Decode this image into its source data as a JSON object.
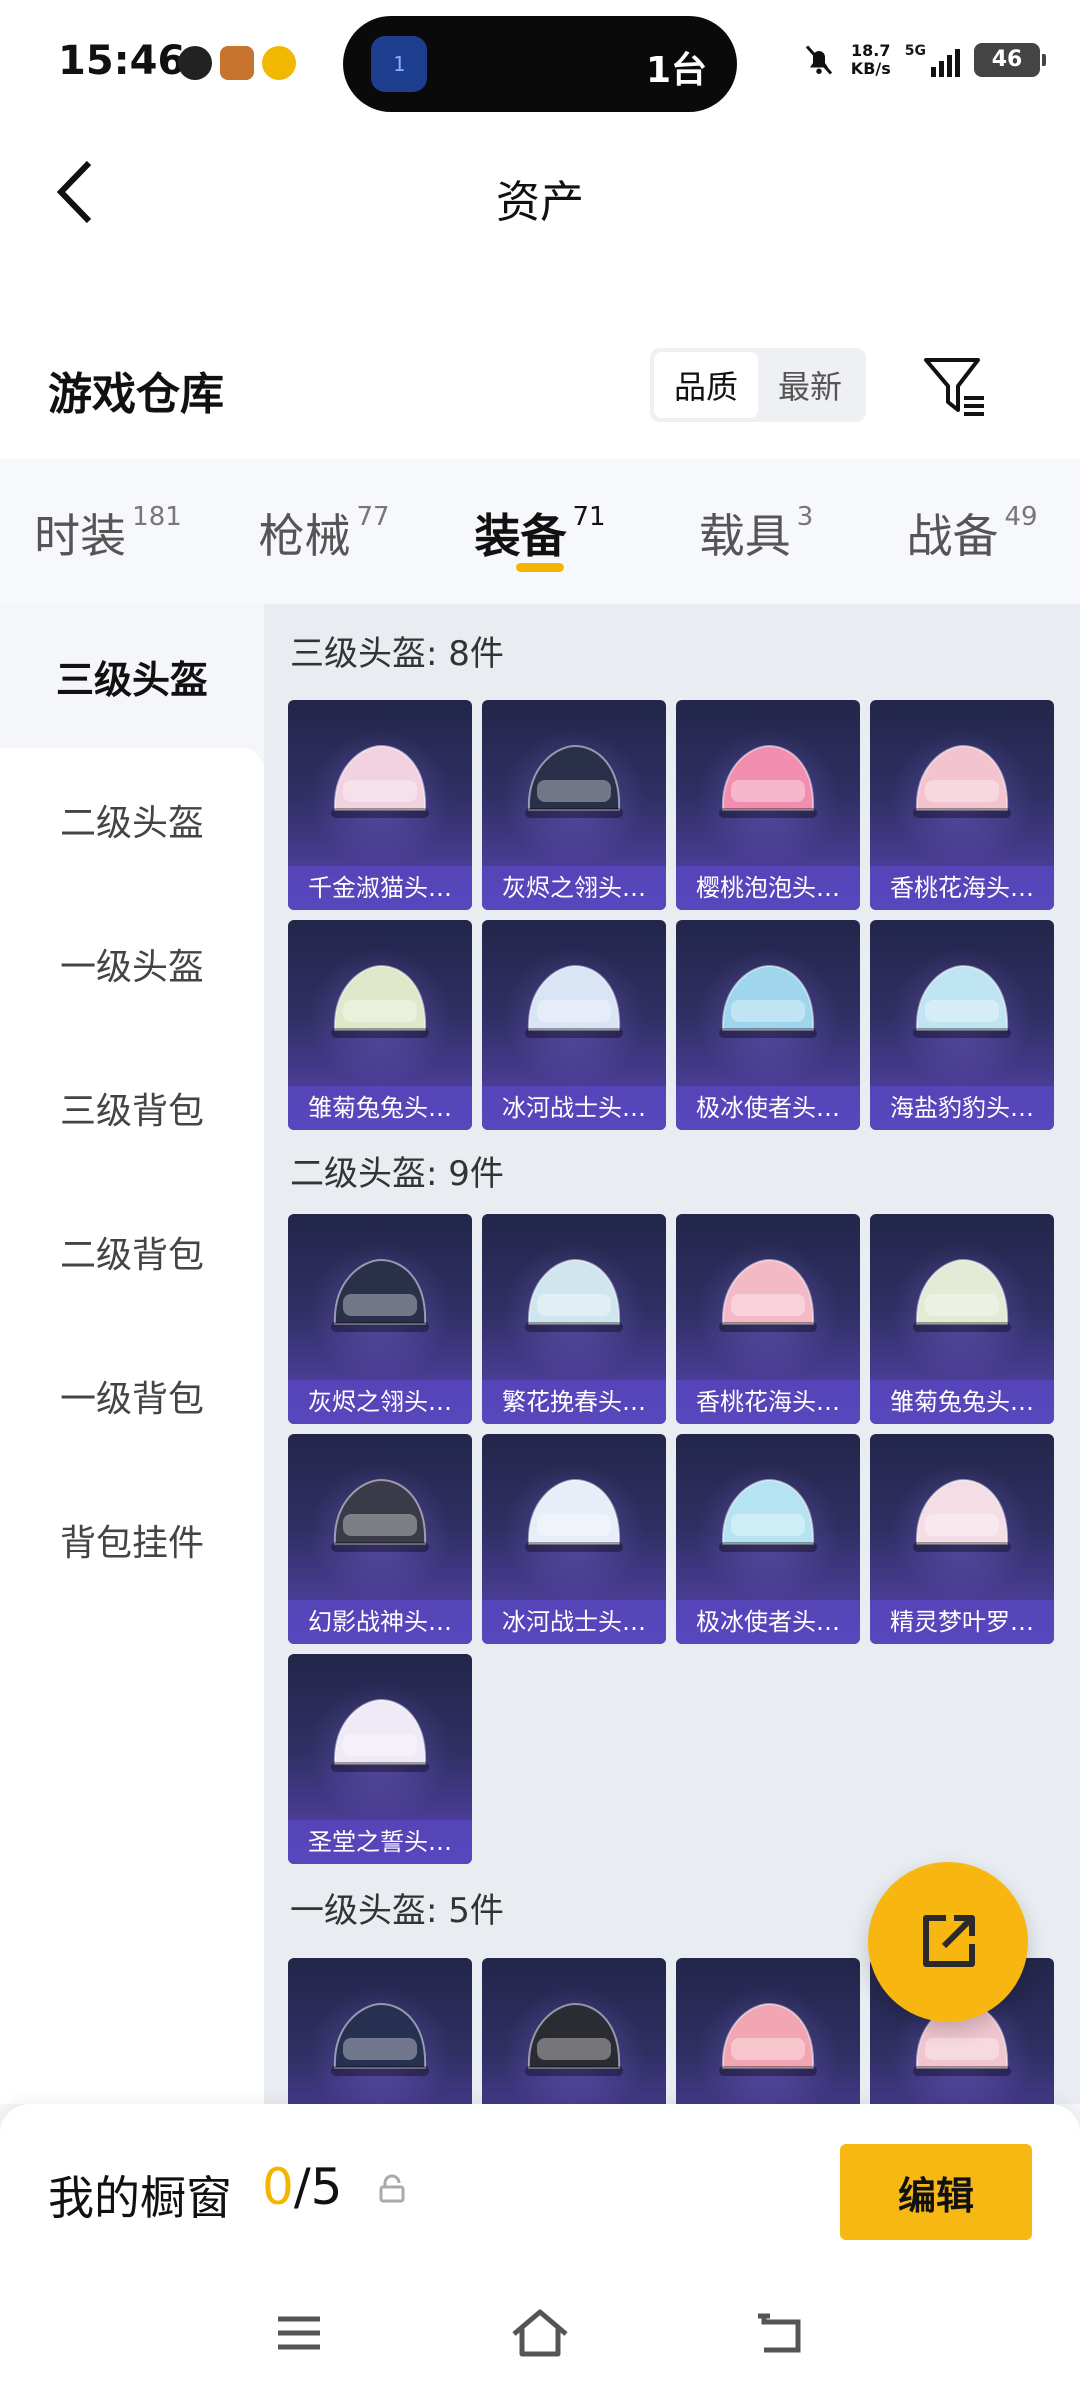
{
  "status_bar": {
    "time": "15:46",
    "island_icon_text": "1",
    "island_text": "1台",
    "net_speed_value": "18.7",
    "net_speed_unit": "KB/s",
    "network": "5G",
    "battery": "46"
  },
  "header": {
    "back_icon": "chevron-left-icon",
    "title": "资产"
  },
  "warehouse": {
    "title": "游戏仓库",
    "sort_options": [
      "品质",
      "最新"
    ],
    "active_sort": "品质",
    "filter_icon": "filter-icon"
  },
  "tabs": [
    {
      "label": "时装",
      "count": "181"
    },
    {
      "label": "枪械",
      "count": "77"
    },
    {
      "label": "装备",
      "count": "71"
    },
    {
      "label": "载具",
      "count": "3"
    },
    {
      "label": "战备",
      "count": "49"
    }
  ],
  "active_tab": "装备",
  "sidebar": [
    {
      "label": "三级头盔"
    },
    {
      "label": "二级头盔"
    },
    {
      "label": "一级头盔"
    },
    {
      "label": "三级背包"
    },
    {
      "label": "二级背包"
    },
    {
      "label": "一级背包"
    },
    {
      "label": "背包挂件"
    }
  ],
  "sections": [
    {
      "title": "三级头盔: 8件",
      "items": [
        {
          "name": "千金淑猫头…",
          "color": "#f2d2e0"
        },
        {
          "name": "灰烬之翎头…",
          "color": "#2a2f4a"
        },
        {
          "name": "樱桃泡泡头…",
          "color": "#f28fb0"
        },
        {
          "name": "香桃花海头…",
          "color": "#f3c3cf"
        },
        {
          "name": "雏菊兔兔头…",
          "color": "#dfe8c8"
        },
        {
          "name": "冰河战士头…",
          "color": "#d9e4f4"
        },
        {
          "name": "极冰使者头…",
          "color": "#9fd6ee"
        },
        {
          "name": "海盐豹豹头…",
          "color": "#bfe4f2"
        }
      ]
    },
    {
      "title": "二级头盔: 9件",
      "items": [
        {
          "name": "灰烬之翎头…",
          "color": "#2a2f4a"
        },
        {
          "name": "繁花挽春头…",
          "color": "#cfe6ee"
        },
        {
          "name": "香桃花海头…",
          "color": "#f4b9c6"
        },
        {
          "name": "雏菊兔兔头…",
          "color": "#e3ead6"
        },
        {
          "name": "幻影战神头…",
          "color": "#3a3a48"
        },
        {
          "name": "冰河战士头…",
          "color": "#e8eef8"
        },
        {
          "name": "极冰使者头…",
          "color": "#b5e3f2"
        },
        {
          "name": "精灵梦叶罗…",
          "color": "#f5dde6"
        },
        {
          "name": "圣堂之誓头…",
          "color": "#efeaf6"
        }
      ]
    },
    {
      "title": "一级头盔: 5件",
      "items": [
        {
          "name": "",
          "color": "#263152"
        },
        {
          "name": "",
          "color": "#2b2b33"
        },
        {
          "name": "",
          "color": "#f2a6b4"
        },
        {
          "name": "",
          "color": "#f1c6cf"
        }
      ]
    }
  ],
  "fab": {
    "icon": "share-external-icon"
  },
  "showcase": {
    "title": "我的橱窗",
    "current": "0",
    "total": "/5",
    "lock_icon": "lock-icon",
    "edit_label": "编辑"
  },
  "nav": {
    "menu_icon": "menu-icon",
    "home_icon": "home-icon",
    "back_icon": "back-icon"
  }
}
